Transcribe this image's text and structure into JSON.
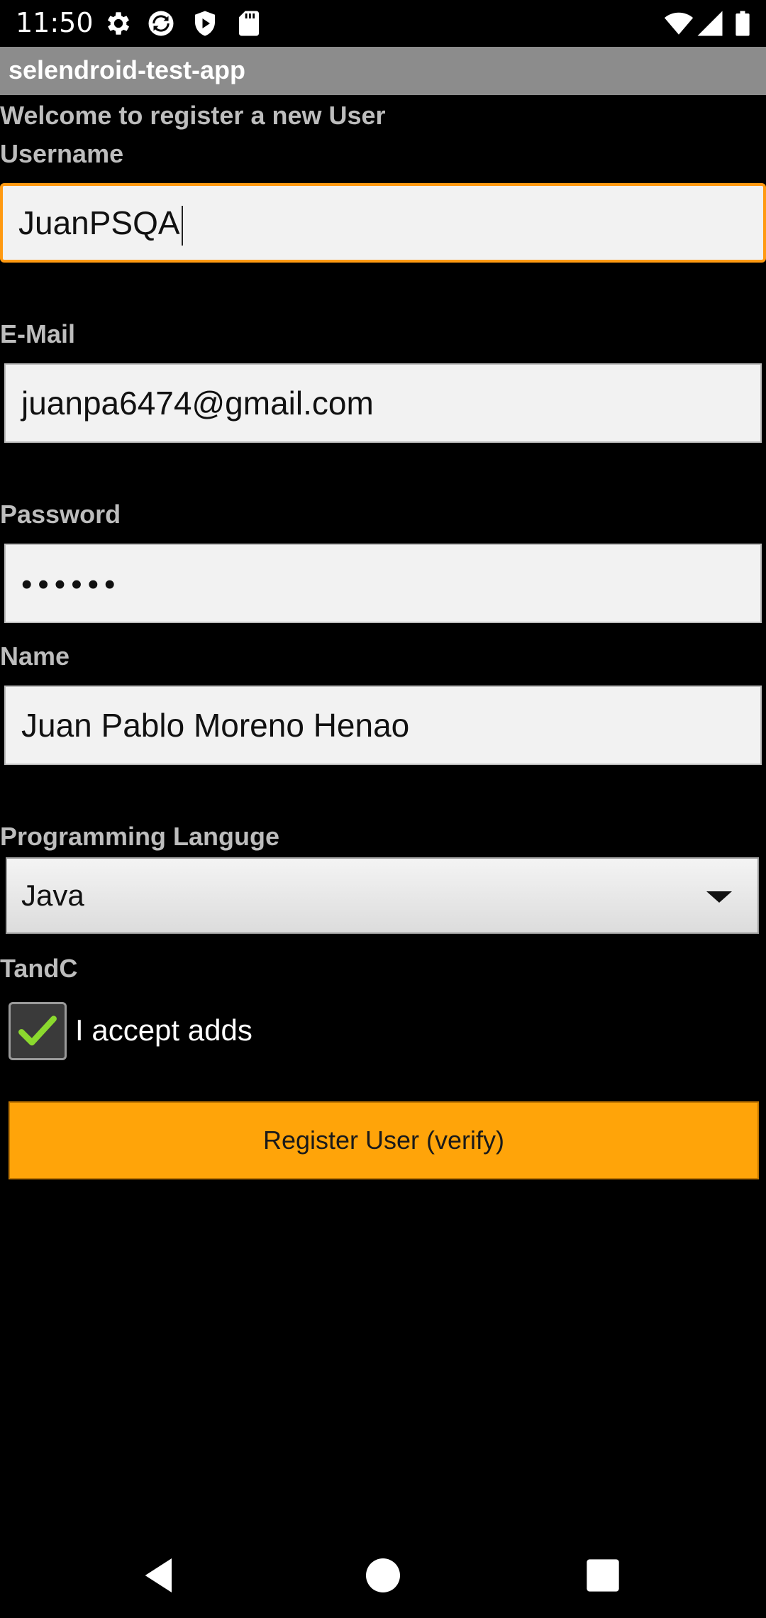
{
  "status_bar": {
    "time": "11:50"
  },
  "app": {
    "title": "selendroid-test-app"
  },
  "form": {
    "welcome": "Welcome to register a new User",
    "username": {
      "label": "Username",
      "value": "JuanPSQA"
    },
    "email": {
      "label": "E-Mail",
      "value": "juanpa6474@gmail.com"
    },
    "password": {
      "label": "Password",
      "value": "••••••"
    },
    "name": {
      "label": "Name",
      "value": "Juan Pablo Moreno Henao"
    },
    "language": {
      "label": "Programming Languge",
      "selected": "Java"
    },
    "tandc": {
      "label": "TandC",
      "checkbox_label": "I accept adds",
      "checked": true
    },
    "submit_label": "Register User (verify)"
  },
  "colors": {
    "accent": "#ffa409",
    "focus_border": "#ff9a12",
    "titlebar": "#8c8c8c"
  }
}
